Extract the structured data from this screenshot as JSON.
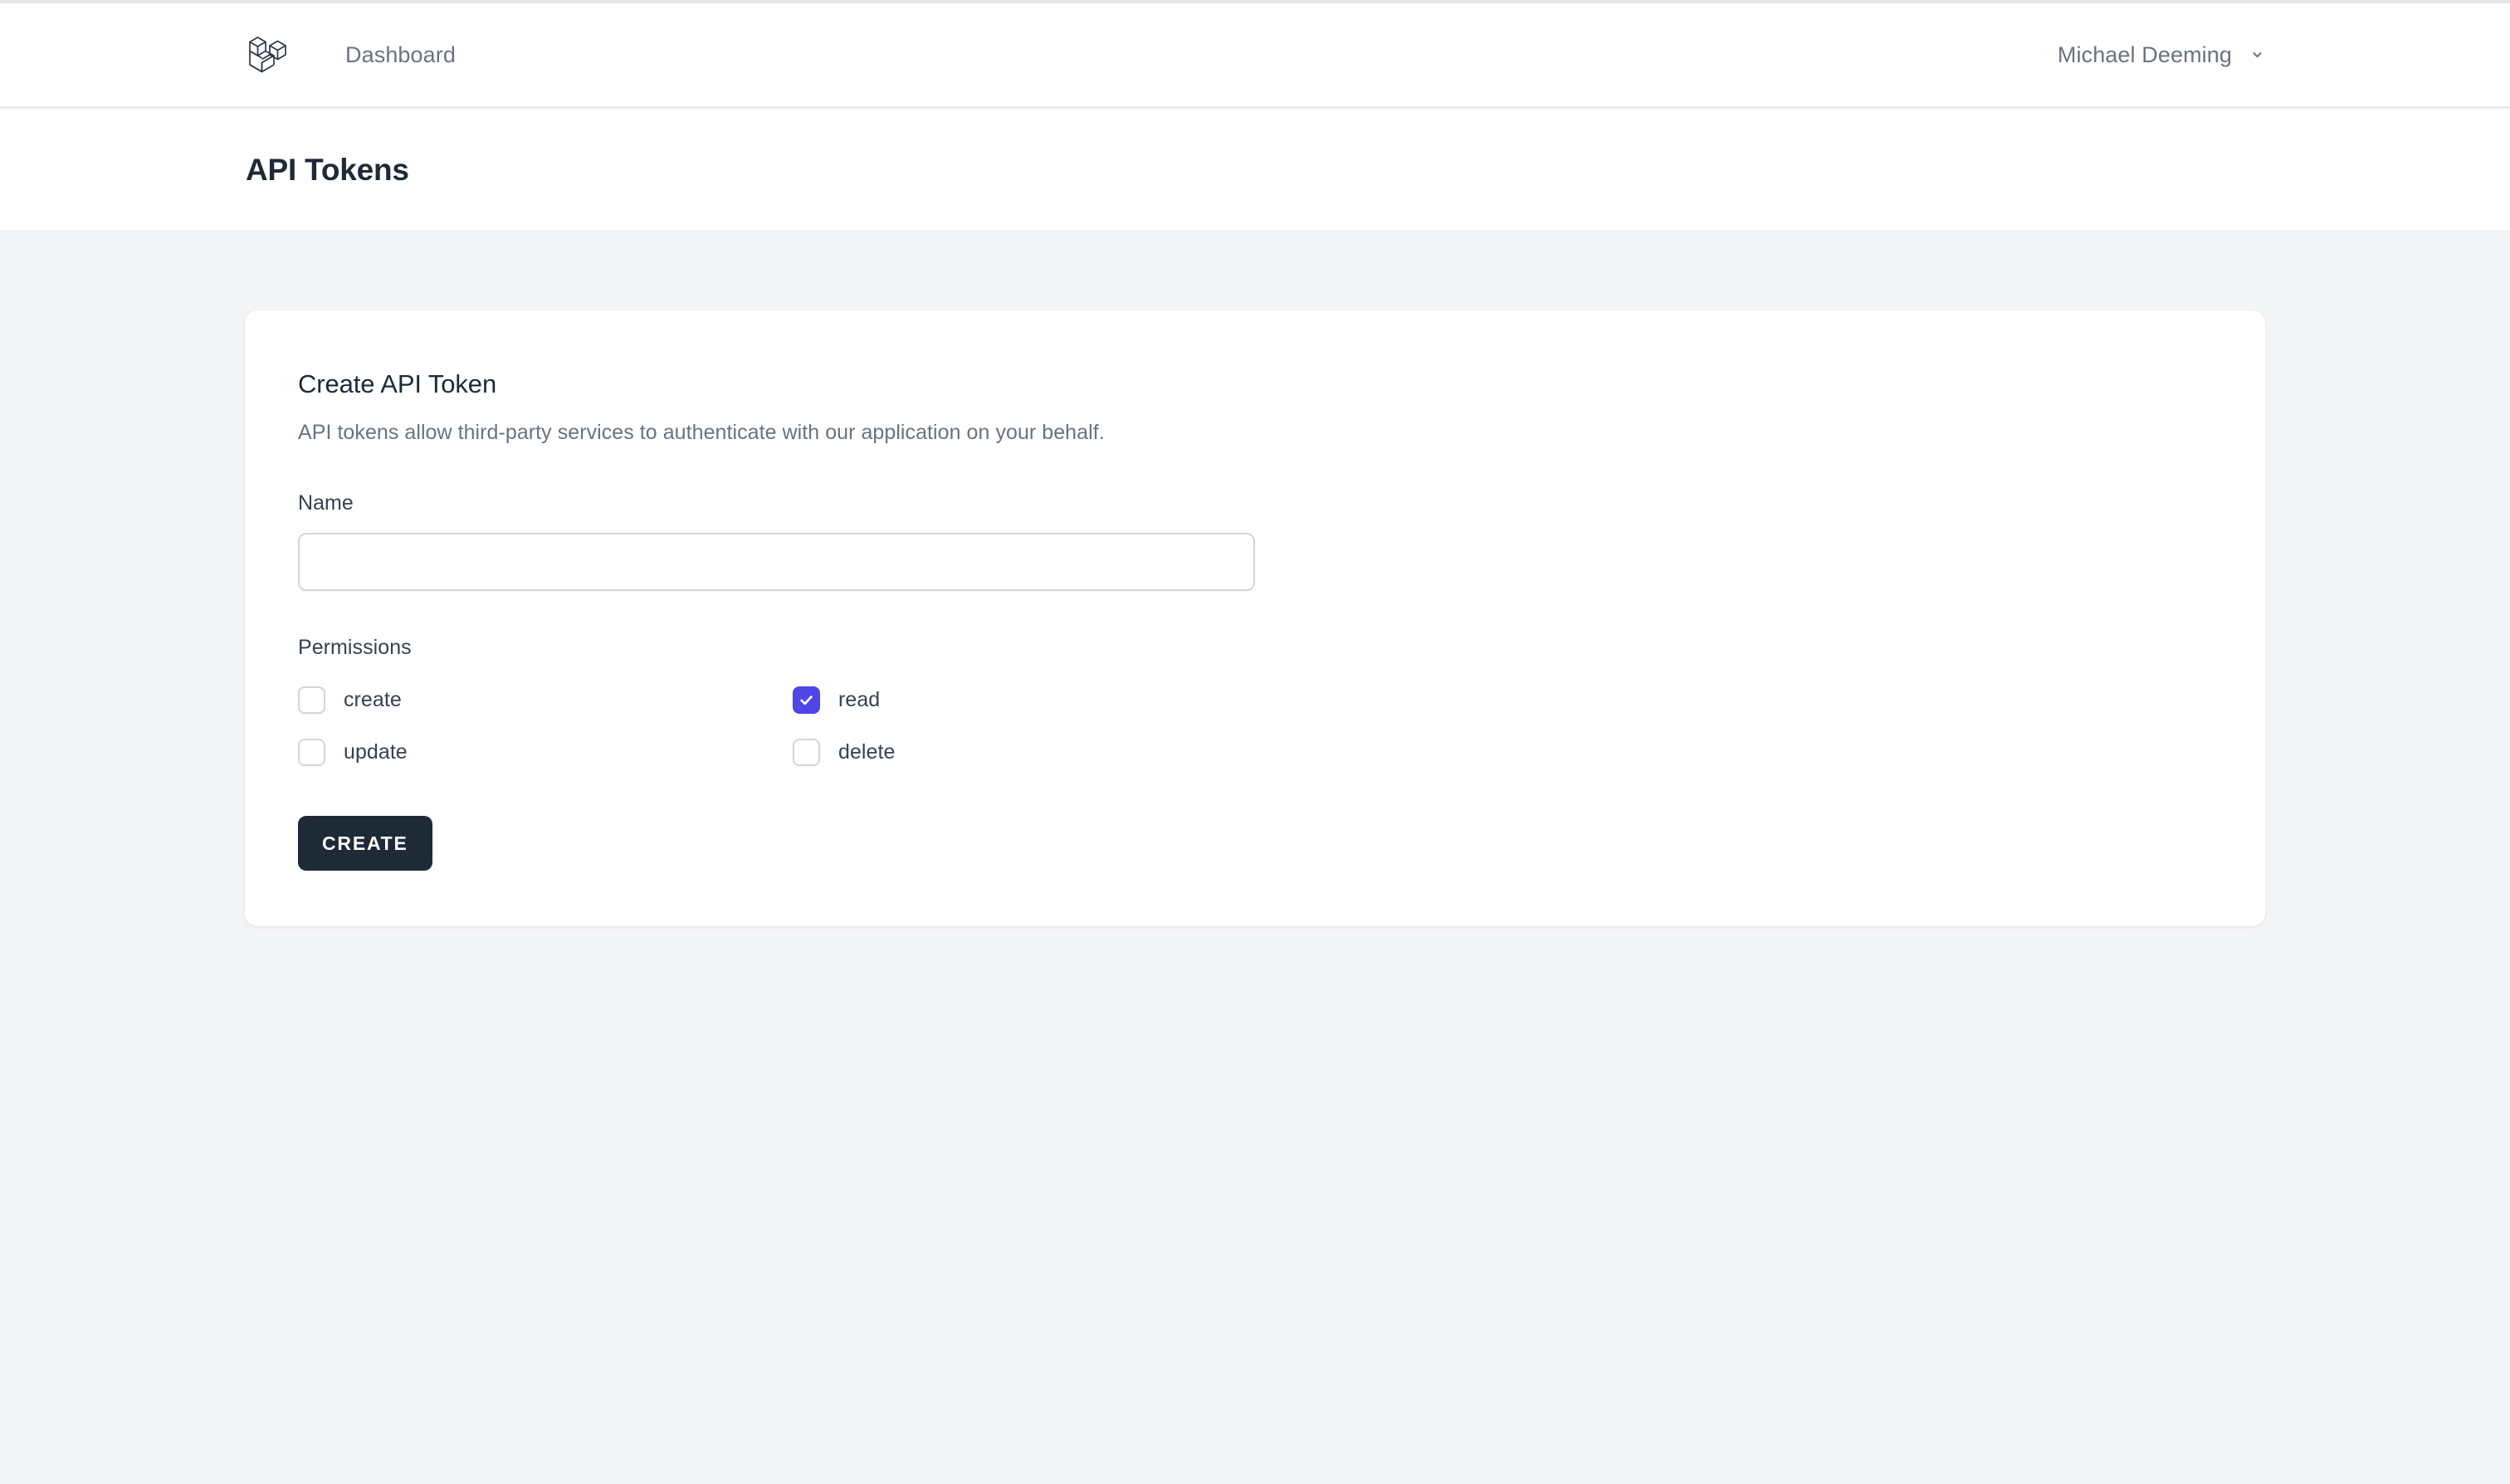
{
  "brand": {
    "logo_icon": "laravel-logo-icon"
  },
  "nav": {
    "links": [
      {
        "label": "Dashboard",
        "name": "nav-link-dashboard"
      }
    ],
    "user": {
      "name": "Michael Deeming",
      "chevron_icon": "chevron-down-icon"
    }
  },
  "page": {
    "title": "API Tokens"
  },
  "card": {
    "title": "Create API Token",
    "description": "API tokens allow third-party services to authenticate with our application on your behalf.",
    "name_field": {
      "label": "Name",
      "value": "",
      "placeholder": ""
    },
    "permissions": {
      "label": "Permissions",
      "items": [
        {
          "label": "create",
          "checked": false
        },
        {
          "label": "read",
          "checked": true
        },
        {
          "label": "update",
          "checked": false
        },
        {
          "label": "delete",
          "checked": false
        }
      ]
    },
    "submit_label": "Create"
  },
  "colors": {
    "accent": "#4f46e5",
    "button_bg": "#1f2a37",
    "page_bg": "#f3f4f6",
    "card_bg": "#ffffff",
    "heading": "#1f2937",
    "muted_text": "#6b7280"
  }
}
